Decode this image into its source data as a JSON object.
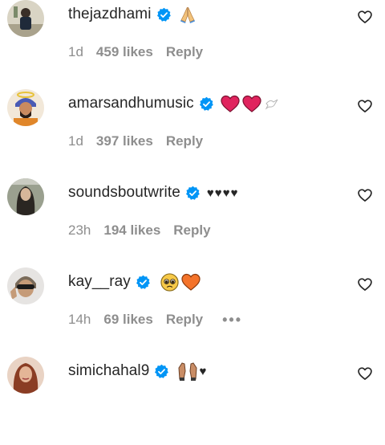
{
  "comments": [
    {
      "username": "thejazdhami",
      "verified": true,
      "emoji": [
        "folded-hands"
      ],
      "time": "1d",
      "likes": "459 likes",
      "reply": "Reply",
      "more": ""
    },
    {
      "username": "amarsandhumusic",
      "verified": true,
      "emoji": [
        "red-heart",
        "red-heart",
        "dove"
      ],
      "time": "1d",
      "likes": "397 likes",
      "reply": "Reply",
      "more": ""
    },
    {
      "username": "soundsboutwrite",
      "verified": true,
      "comment_text": "♥♥♥♥",
      "time": "23h",
      "likes": "194 likes",
      "reply": "Reply",
      "more": ""
    },
    {
      "username": "kay__ray",
      "verified": true,
      "emoji": [
        "pleading-face",
        "orange-heart"
      ],
      "time": "14h",
      "likes": "69 likes",
      "reply": "Reply",
      "more": "•••"
    },
    {
      "username": "simichahal9",
      "verified": true,
      "emoji": [
        "raised-hands"
      ],
      "comment_text": "♥",
      "time": "",
      "likes": "",
      "reply": "",
      "more": ""
    }
  ],
  "colors": {
    "username": "#262626",
    "meta": "#8e8e8e",
    "verified": "#0095f6",
    "red_heart": "#e0245e",
    "orange_heart": "#f4732a"
  }
}
